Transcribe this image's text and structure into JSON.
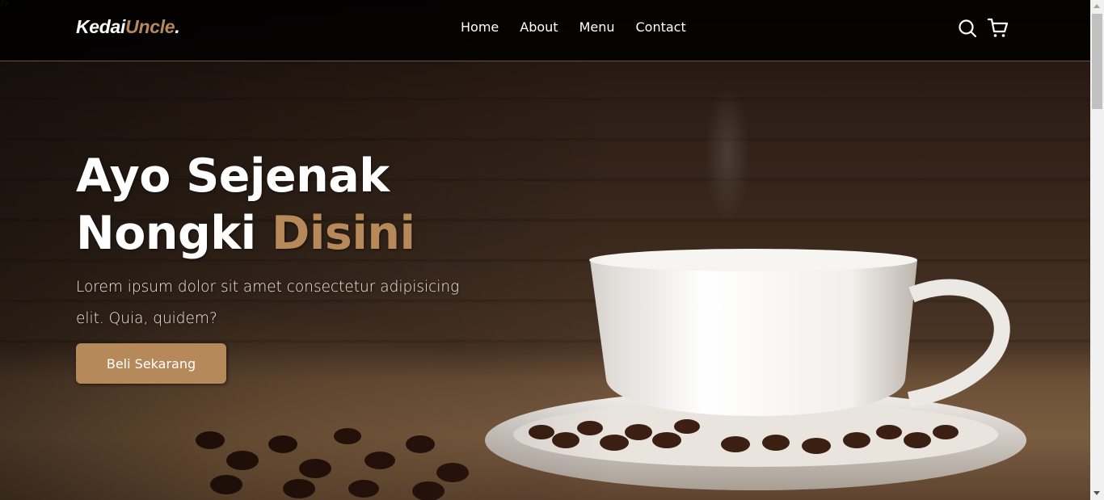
{
  "brand": {
    "name_main": "Kedai",
    "name_accent": "Uncle",
    "name_dot": "."
  },
  "nav": {
    "links": [
      {
        "label": "Home"
      },
      {
        "label": "About"
      },
      {
        "label": "Menu"
      },
      {
        "label": "Contact"
      }
    ],
    "icons": [
      "search-icon",
      "shopping-cart-icon"
    ]
  },
  "hero": {
    "title_line1": "Ayo Sejenak",
    "title_line2_main": "Nongki ",
    "title_line2_accent": "Disini",
    "description": "Lorem ipsum dolor sit amet consectetur adipisicing elit. Quia, quidem?",
    "cta_label": "Beli Sekarang",
    "image_subject": "cup of coffee on saucer with roasted coffee beans"
  },
  "page_glyph": "/>",
  "colors": {
    "accent": "#b6895b",
    "navbar_bg": "#000000",
    "text_primary": "#ffffff"
  }
}
